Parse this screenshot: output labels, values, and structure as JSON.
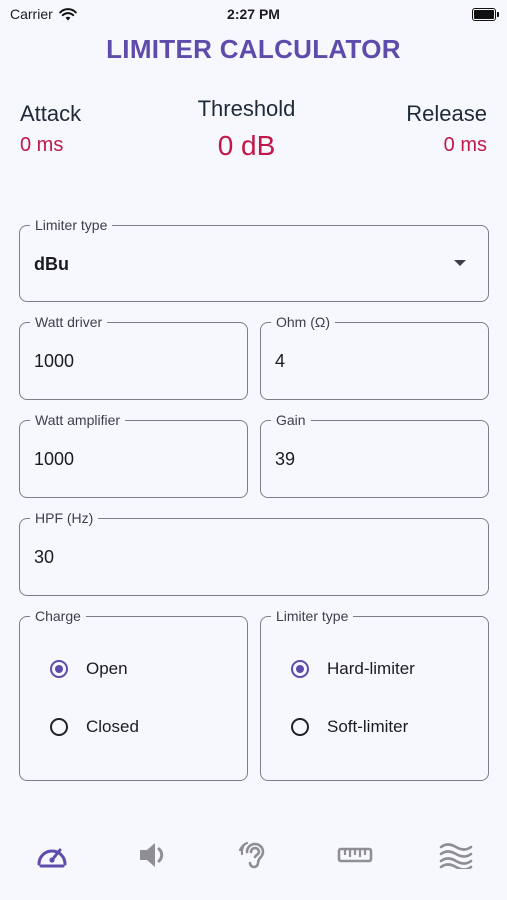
{
  "status": {
    "carrier": "Carrier",
    "time": "2:27 PM"
  },
  "title": "LIMITER CALCULATOR",
  "metrics": {
    "attack": {
      "label": "Attack",
      "value": "0 ms"
    },
    "threshold": {
      "label": "Threshold",
      "value": "0 dB"
    },
    "release": {
      "label": "Release",
      "value": "0 ms"
    }
  },
  "form": {
    "limiter_type": {
      "label": "Limiter type",
      "value": "dBu"
    },
    "watt_driver": {
      "label": "Watt driver",
      "value": "1000"
    },
    "ohm": {
      "label": "Ohm (Ω)",
      "value": "4"
    },
    "watt_amplifier": {
      "label": "Watt amplifier",
      "value": "1000"
    },
    "gain": {
      "label": "Gain",
      "value": "39"
    },
    "hpf": {
      "label": "HPF (Hz)",
      "value": "30"
    }
  },
  "charge": {
    "label": "Charge",
    "options": [
      {
        "label": "Open",
        "checked": true
      },
      {
        "label": "Closed",
        "checked": false
      }
    ]
  },
  "limiter_mode": {
    "label": "Limiter type",
    "options": [
      {
        "label": "Hard-limiter",
        "checked": true
      },
      {
        "label": "Soft-limiter",
        "checked": false
      }
    ]
  },
  "nav": {
    "items": [
      {
        "icon": "speedometer-icon",
        "active": true
      },
      {
        "icon": "speaker-icon",
        "active": false
      },
      {
        "icon": "ear-icon",
        "active": false
      },
      {
        "icon": "ruler-icon",
        "active": false
      },
      {
        "icon": "waves-icon",
        "active": false
      }
    ]
  },
  "colors": {
    "accent": "#5f4bab",
    "value_red": "#c0184a",
    "background": "#f7f8fd",
    "inactive_icon": "#8e8e93"
  }
}
